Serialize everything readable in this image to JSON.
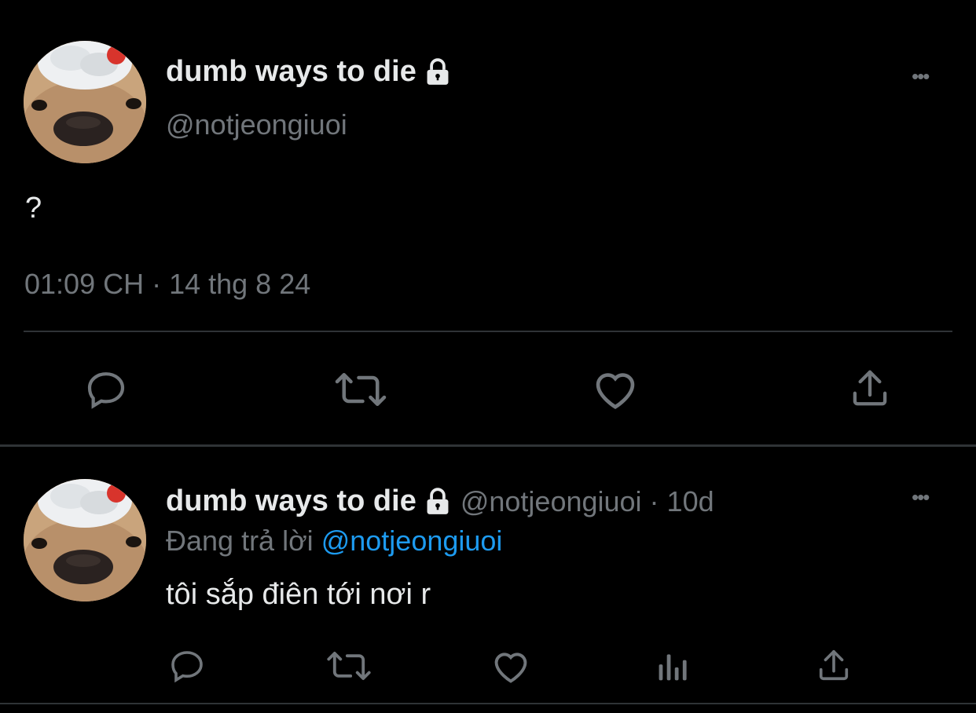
{
  "tweet": {
    "display_name": "dumb ways to die",
    "handle": "@notjeongiuoi",
    "text": "?",
    "timestamp": "01:09 CH · 14 thg 8 24",
    "more_label": "•••"
  },
  "reply": {
    "display_name": "dumb ways to die",
    "handle": "@notjeongiuoi",
    "separator": "·",
    "age": "10d",
    "replying_prefix": "Đang trả lời",
    "replying_to": "@notjeongiuoi",
    "text": "tôi sắp điên tới nơi r",
    "more_label": "•••"
  },
  "colors": {
    "background": "#000000",
    "text_primary": "#e7e9ea",
    "text_secondary": "#71767b",
    "accent": "#1d9bf0",
    "divider": "#2f3336"
  },
  "icons": {
    "lock": "lock-icon",
    "reply": "comment-icon",
    "retweet": "retweet-icon",
    "like": "heart-icon",
    "share": "share-icon",
    "analytics": "analytics-icon",
    "more": "more-icon"
  }
}
